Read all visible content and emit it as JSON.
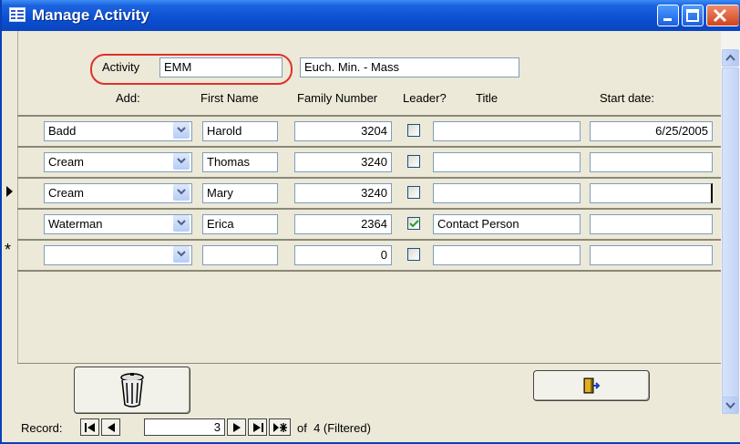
{
  "window": {
    "title": "Manage Activity"
  },
  "header": {
    "activity_label": "Activity",
    "activity_code": "EMM",
    "activity_name": "Euch. Min. - Mass"
  },
  "columns": {
    "add": "Add:",
    "first_name": "First Name",
    "family_number": "Family Number",
    "leader": "Leader?",
    "title": "Title",
    "start_date": "Start date:"
  },
  "rows": [
    {
      "add": "Badd",
      "first_name": "Harold",
      "family_number": "3204",
      "leader": false,
      "title": "",
      "start_date": "6/25/2005"
    },
    {
      "add": "Cream",
      "first_name": "Thomas",
      "family_number": "3240",
      "leader": false,
      "title": "",
      "start_date": ""
    },
    {
      "add": "Cream",
      "first_name": "Mary",
      "family_number": "3240",
      "leader": false,
      "title": "",
      "start_date": ""
    },
    {
      "add": "Waterman",
      "first_name": "Erica",
      "family_number": "2364",
      "leader": true,
      "title": "Contact Person",
      "start_date": ""
    },
    {
      "add": "",
      "first_name": "",
      "family_number": "0",
      "leader": false,
      "title": "",
      "start_date": ""
    }
  ],
  "current_row_index": 2,
  "new_row_marker": "*",
  "buttons": {
    "delete_icon": "trash-can-icon",
    "exit_icon": "exit-door-icon"
  },
  "navigation": {
    "record_label": "Record:",
    "current_record": "3",
    "of_text": "of  4 (Filtered)"
  },
  "colors": {
    "titlebar": "#0b4fd2",
    "highlight_ring": "#e0302a",
    "form_background": "#ece9d8"
  }
}
